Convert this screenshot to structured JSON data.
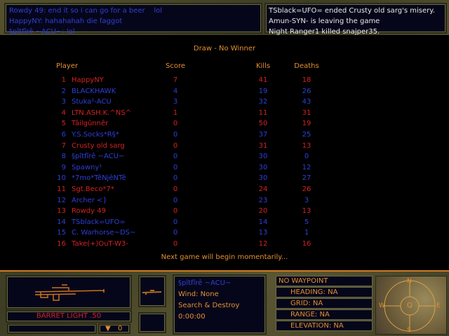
{
  "chat": [
    "Rowdy 49: end it so i can go for a beer    lol",
    "HappyNY: hahahahah die faggot",
    "§pîtfîrê ~ACU~: lol"
  ],
  "killfeed": [
    "TSblack=UFO= ended Crusty old sarg's misery.",
    "Amun-SYN- is leaving the game",
    "Night Ranger1 killed snajper35."
  ],
  "scoreboard": {
    "title": "Draw - No Winner",
    "headers": {
      "player": "Player",
      "score": "Score",
      "kills": "Kills",
      "deaths": "Deaths"
    },
    "rows": [
      {
        "n": "1",
        "name": "HappyNY",
        "score": "7",
        "kills": "41",
        "deaths": "18",
        "team": "red"
      },
      {
        "n": "2",
        "name": "BLACKHAWK",
        "score": "4",
        "kills": "19",
        "deaths": "26",
        "team": "blue"
      },
      {
        "n": "3",
        "name": "Stuka¹-ACU",
        "score": "3",
        "kills": "32",
        "deaths": "43",
        "team": "blue"
      },
      {
        "n": "4",
        "name": "LTN.ASH.K.^NS^",
        "score": "1",
        "kills": "11",
        "deaths": "31",
        "team": "red"
      },
      {
        "n": "5",
        "name": "Tâilgûnnêr",
        "score": "0",
        "kills": "50",
        "deaths": "19",
        "team": "red"
      },
      {
        "n": "6",
        "name": "Y.S.Socks*R§*",
        "score": "0",
        "kills": "37",
        "deaths": "25",
        "team": "blue"
      },
      {
        "n": "7",
        "name": "Crusty old sarg",
        "score": "0",
        "kills": "31",
        "deaths": "13",
        "team": "red"
      },
      {
        "n": "8",
        "name": "§pîtfîrê ~ACU~",
        "score": "0",
        "kills": "30",
        "deaths": "0",
        "team": "blue"
      },
      {
        "n": "9",
        "name": "Spawny¹",
        "score": "0",
        "kills": "30",
        "deaths": "12",
        "team": "blue"
      },
      {
        "n": "10",
        "name": "*7mo*TêNjêNTê",
        "score": "0",
        "kills": "30",
        "deaths": "27",
        "team": "blue"
      },
      {
        "n": "11",
        "name": "Sgt.Beco*7*",
        "score": "0",
        "kills": "24",
        "deaths": "26",
        "team": "red"
      },
      {
        "n": "12",
        "name": "Archer <}",
        "score": "0",
        "kills": "23",
        "deaths": "3",
        "team": "blue"
      },
      {
        "n": "13",
        "name": "Rowdy 49",
        "score": "0",
        "kills": "20",
        "deaths": "13",
        "team": "red"
      },
      {
        "n": "14",
        "name": "TSblack=UFO=",
        "score": "0",
        "kills": "14",
        "deaths": "5",
        "team": "blue"
      },
      {
        "n": "15",
        "name": "C. Warhorse~DS~",
        "score": "0",
        "kills": "13",
        "deaths": "1",
        "team": "blue"
      },
      {
        "n": "16",
        "name": "Take(+)OuT-W3-",
        "score": "0",
        "kills": "12",
        "deaths": "16",
        "team": "red"
      }
    ],
    "footer": "Next game will begin momentarily..."
  },
  "hud": {
    "weapon_name": "BARRET LIGHT .50",
    "ammo_count": "0",
    "player": "§pîtfîrê ~ACU~",
    "wind": "Wind: None",
    "mode": "Search & Destroy",
    "time": "0:00:00",
    "waypoint": "NO WAYPOINT",
    "heading": "HEADING: NA",
    "grid": "GRID: NA",
    "range": "RANGE: NA",
    "elevation": "ELEVATION: NA",
    "compass": {
      "n": "N",
      "s": "S",
      "e": "E",
      "w": "W",
      "center": "Q"
    }
  },
  "colors": {
    "red": "#d42222",
    "blue": "#2f3fd8",
    "orange": "#e39031"
  }
}
